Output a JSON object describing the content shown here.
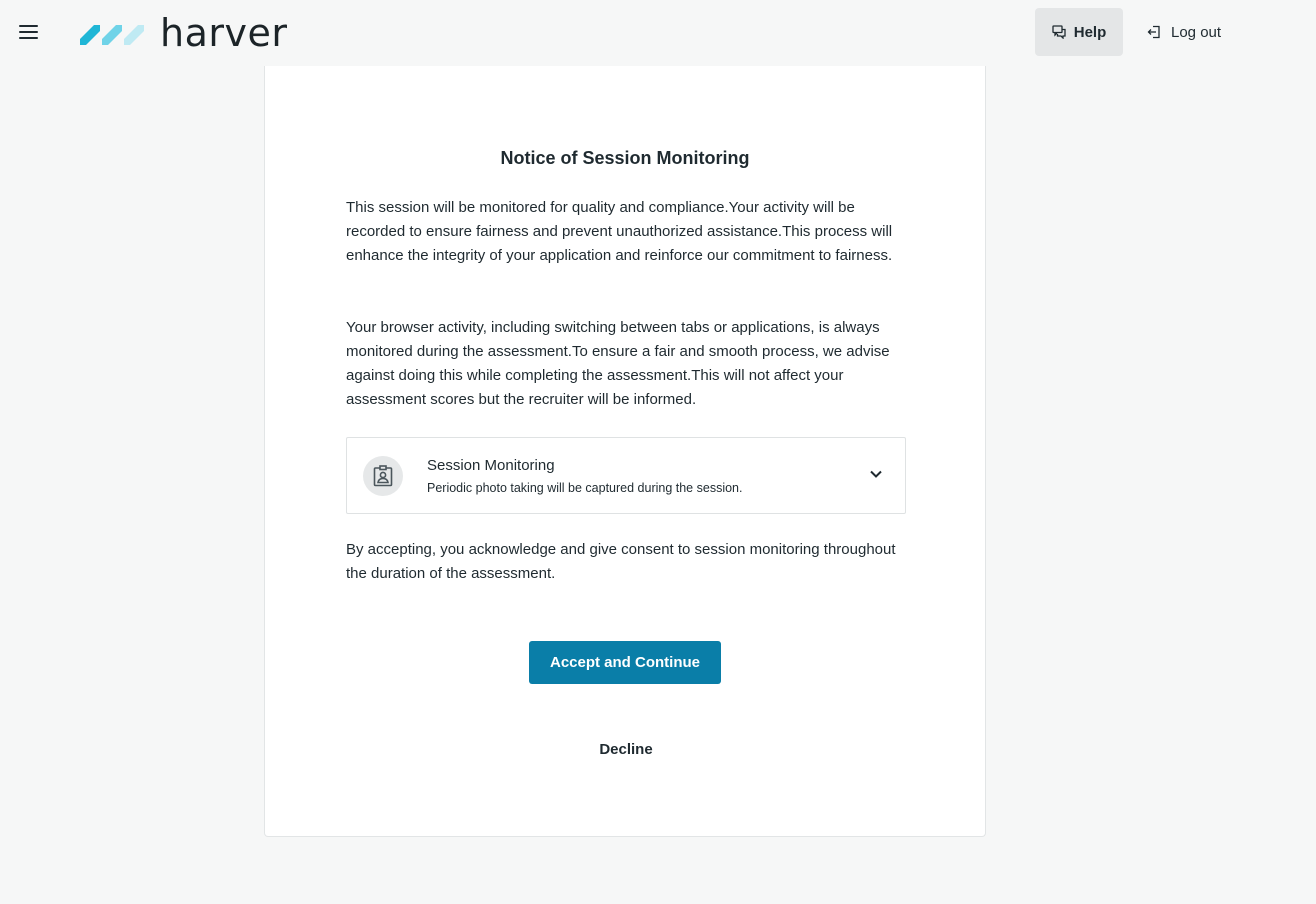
{
  "header": {
    "brand_name": "harver",
    "help_label": "Help",
    "logout_label": "Log out"
  },
  "icons": {
    "menu": "hamburger-menu-icon",
    "logo": "harver-logo-stripes",
    "help": "chat-bubbles-icon",
    "logout": "log-out-arrow-icon",
    "monitoring": "id-badge-icon",
    "expand": "chevron-down-icon"
  },
  "colors": {
    "primary": "#0a7ea8",
    "logo_dark": "#1fb6d6",
    "logo_mid": "#6fd3e8",
    "logo_light": "#bfeaf3",
    "background": "#f6f7f7"
  },
  "notice": {
    "title": "Notice of Session Monitoring",
    "paragraph_1": "This session will be monitored for quality and compliance.Your activity will be recorded to ensure fairness and prevent unauthorized assistance.This process will enhance the integrity of your application and reinforce our commitment to fairness.",
    "paragraph_2": "Your browser activity, including switching between tabs or applications, is always monitored during the assessment.To ensure a fair and smooth process, we advise against doing this while completing the assessment.This will not affect your assessment scores but the recruiter will be informed.",
    "accordion": {
      "title": "Session Monitoring",
      "subtitle": "Periodic photo taking will be captured during the session."
    },
    "consent": "By accepting, you acknowledge and give consent to session monitoring throughout the duration of the assessment.",
    "accept_label": "Accept and Continue",
    "decline_label": "Decline"
  }
}
